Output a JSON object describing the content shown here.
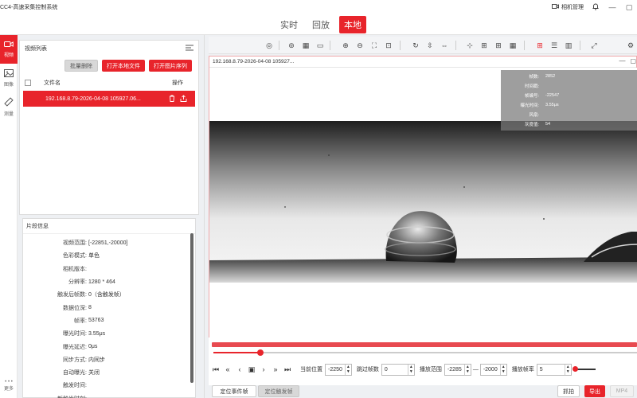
{
  "app": {
    "title": "CC4-高速采集控制系统",
    "camera_manager": "相机管理"
  },
  "mode_tabs": [
    {
      "label": "实时",
      "active": false
    },
    {
      "label": "回放",
      "active": false
    },
    {
      "label": "本地",
      "active": true
    }
  ],
  "sidebar": {
    "items": [
      {
        "label": "视频",
        "icon": "video-icon",
        "active": true
      },
      {
        "label": "图像",
        "icon": "image-icon",
        "active": false
      },
      {
        "label": "测量",
        "icon": "ruler-icon",
        "active": false
      }
    ],
    "more_label": "更多"
  },
  "video_list": {
    "title": "视频列表",
    "buttons": {
      "batch_delete": "批量删除",
      "open_local": "打开本地文件",
      "open_image_seq": "打开图片序列"
    },
    "columns": {
      "name": "文件名",
      "action": "操作"
    },
    "rows": [
      {
        "name": "192.168.8.79-2026-04-08 105927.06...",
        "selected": true
      }
    ]
  },
  "clip_info": {
    "title": "片段信息",
    "rows": [
      {
        "key": "视频范围:",
        "value": "[-22851,-20000]"
      },
      {
        "key": "色彩模式:",
        "value": "单色"
      },
      {
        "key": "相机版本:",
        "value": ""
      },
      {
        "key": "分辨率:",
        "value": "1280 * 464"
      },
      {
        "key": "触发后帧数:",
        "value": "0（含触发帧）"
      },
      {
        "key": "数据位深:",
        "value": "8"
      },
      {
        "key": "帧率:",
        "value": "53763"
      },
      {
        "key": "曝光时间:",
        "value": "3.55μs"
      },
      {
        "key": "曝光延迟:",
        "value": "0μs"
      },
      {
        "key": "同步方式:",
        "value": "内同步"
      },
      {
        "key": "自动曝光:",
        "value": "关闭"
      },
      {
        "key": "触发时间:",
        "value": ""
      },
      {
        "key": "新触发时刻:",
        "value": ""
      }
    ]
  },
  "viewer": {
    "title": "192.168.8.79-2026-04-08 105927...",
    "overlay": [
      {
        "key": "帧数:",
        "value": "2852"
      },
      {
        "key": "时间戳:",
        "value": ""
      },
      {
        "key": "帧编号:",
        "value": "-22547"
      },
      {
        "key": "曝光时间:",
        "value": "3.55μs"
      },
      {
        "key": "风扇:",
        "value": ""
      },
      {
        "key": "灰度值:",
        "value": "54"
      }
    ]
  },
  "playback": {
    "progress": 0.11,
    "current_label": "当前位置",
    "current_value": "-2250",
    "skip_label": "跳过帧数",
    "skip_value": "0",
    "range_label": "播放范围",
    "range_start": "-2285",
    "range_end": "-2000",
    "rate_label": "播放帧率",
    "rate_value": "5"
  },
  "bottom": {
    "locate_event_frame": "定位事件帧",
    "locate_trigger_frame": "定位触发帧",
    "capture": "抓拍",
    "export": "导出",
    "mp4": "MP4"
  },
  "colors": {
    "accent": "#e8242b"
  }
}
